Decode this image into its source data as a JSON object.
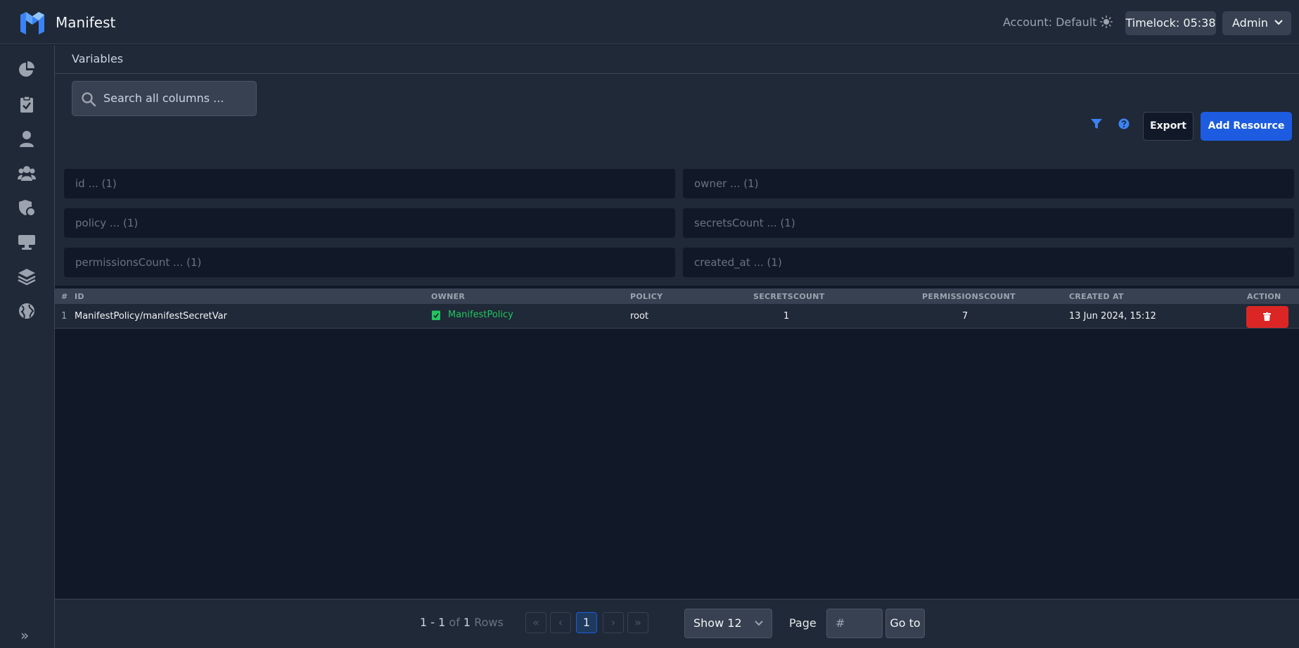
{
  "header": {
    "app_title": "Manifest",
    "account": "Account: Default",
    "timelock": "Timelock: 05:38",
    "user_menu": "Admin"
  },
  "sidebar": {
    "items": [
      {
        "icon": "chart-pie-icon"
      },
      {
        "icon": "clipboard-check-icon"
      },
      {
        "icon": "user-icon"
      },
      {
        "icon": "users-icon"
      },
      {
        "icon": "shield-icon"
      },
      {
        "icon": "desktop-icon"
      },
      {
        "icon": "layers-icon"
      },
      {
        "icon": "globe-icon"
      }
    ],
    "expand": "»"
  },
  "page": {
    "title": "Variables"
  },
  "toolbar": {
    "search_placeholder": "Search all columns ...",
    "export_label": "Export",
    "add_label": "Add Resource"
  },
  "filters": [
    "id ... (1)",
    "owner ... (1)",
    "policy ... (1)",
    "secretsCount ... (1)",
    "permissionsCount ... (1)",
    "created_at ... (1)"
  ],
  "table": {
    "headers": [
      "#",
      "ID",
      "OWNER",
      "POLICY",
      "SECRETSCOUNT",
      "PERMISSIONSCOUNT",
      "CREATED AT",
      "ACTION"
    ],
    "rows": [
      {
        "num": "1",
        "id": "ManifestPolicy/manifestSecretVar",
        "owner": "ManifestPolicy",
        "policy": "root",
        "secrets_count": "1",
        "permissions_count": "7",
        "created_at": "13 Jun 2024, 15:12"
      }
    ]
  },
  "pagination": {
    "range": "1 - 1",
    "of": "of",
    "total": "1",
    "rows_label": "Rows",
    "first": "«",
    "prev": "‹",
    "current_page": "1",
    "next": "›",
    "last": "»",
    "show": "Show 12",
    "page_label": "Page",
    "page_placeholder": "#",
    "goto_label": "Go to"
  },
  "colors": {
    "accent": "#1d5ce0",
    "danger": "#dc2626",
    "owner_link": "#22c55e"
  }
}
